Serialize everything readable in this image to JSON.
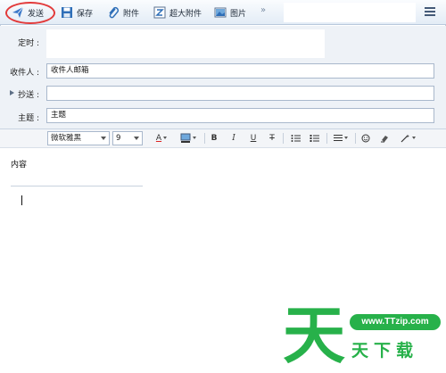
{
  "toolbar": {
    "send": "发送",
    "save": "保存",
    "attach": "附件",
    "big_attach": "超大附件",
    "picture": "图片",
    "more": "»"
  },
  "form": {
    "timer_label": "定时 :",
    "to_label": "收件人 :",
    "to_value": "收件人邮箱",
    "cc_label": "抄送 :",
    "cc_value": "",
    "subject_label": "主题 :",
    "subject_value": "主题"
  },
  "format": {
    "font": "微软雅黑",
    "size": "9",
    "font_color_glyph": "A",
    "bold": "B",
    "italic": "I",
    "underline": "U",
    "strike": "T"
  },
  "editor": {
    "content": "内容"
  },
  "watermark": {
    "logo_glyph": "天",
    "url": "www.TTzip.com",
    "name": "天下载",
    "color": "#27b14a"
  }
}
